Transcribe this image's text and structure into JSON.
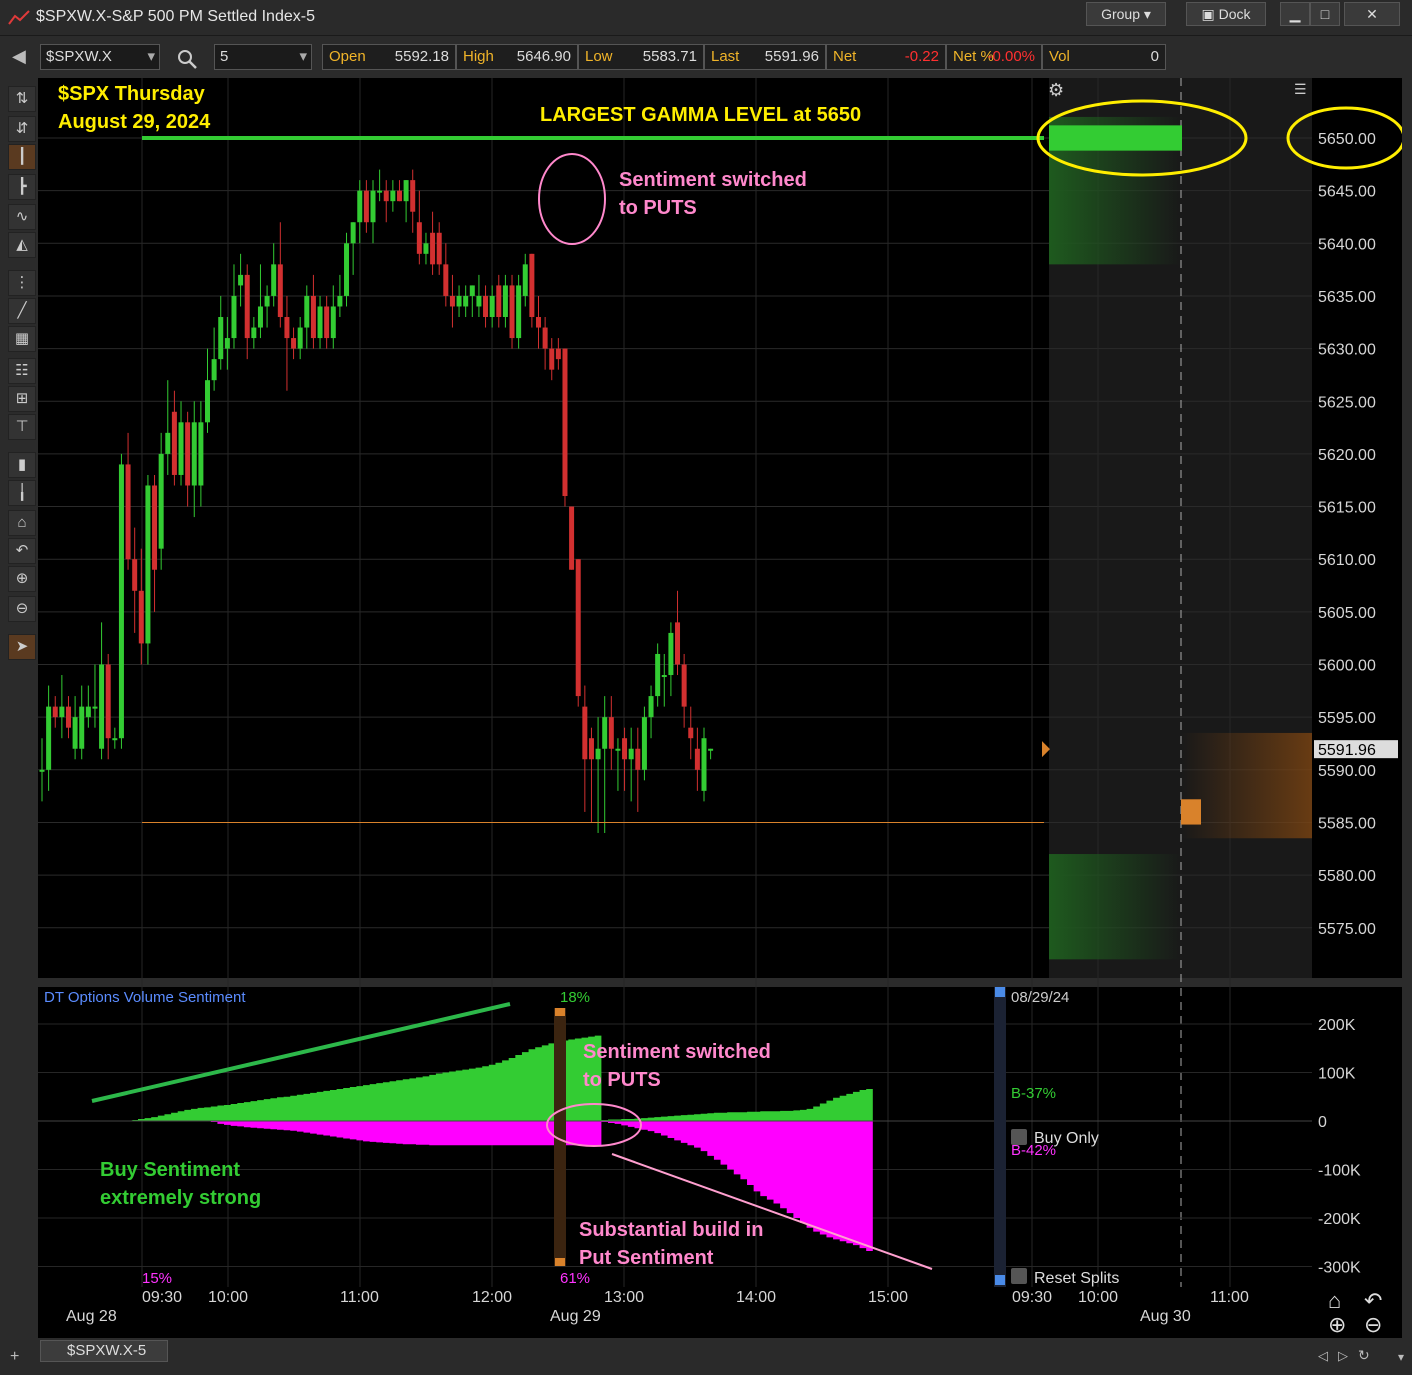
{
  "window": {
    "title": "$SPXW.X-S&P 500 PM Settled Index-5",
    "group_label": "Group",
    "dock_label": "Dock"
  },
  "toolbar": {
    "symbol": "$SPXW.X",
    "interval": "5",
    "quote": [
      {
        "label": "Open",
        "value": "5592.18",
        "neg": false
      },
      {
        "label": "High",
        "value": "5646.90",
        "neg": false
      },
      {
        "label": "Low",
        "value": "5583.71",
        "neg": false
      },
      {
        "label": "Last",
        "value": "5591.96",
        "neg": false
      },
      {
        "label": "Net",
        "value": "-0.22",
        "neg": true
      },
      {
        "label": "Net %",
        "value": "-0.00%",
        "neg": true
      },
      {
        "label": "Vol",
        "value": "0",
        "neg": false
      }
    ]
  },
  "annotations": {
    "title_line1": "$SPX Thursday",
    "title_line2": "August 29, 2024",
    "gamma": "LARGEST GAMMA LEVEL at 5650",
    "sentiment_top_1": "Sentiment switched",
    "sentiment_top_2": "to PUTS",
    "sentiment_bottom_1": "Sentiment switched",
    "sentiment_bottom_2": "to PUTS",
    "buy_1": "Buy Sentiment",
    "buy_2": "extremely strong",
    "put_1": "Substantial build in",
    "put_2": "Put Sentiment"
  },
  "price_axis": {
    "ticks": [
      "5650.00",
      "5645.00",
      "5640.00",
      "5635.00",
      "5630.00",
      "5625.00",
      "5620.00",
      "5615.00",
      "5610.00",
      "5605.00",
      "5600.00",
      "5595.00",
      "5590.00",
      "5585.00",
      "5580.00",
      "5575.00"
    ],
    "last_price_tag": "5591.96"
  },
  "sentiment_panel": {
    "title": "DT Options Volume Sentiment",
    "axis_ticks": [
      "200K",
      "100K",
      "0",
      "-100K",
      "-200K",
      "-300K"
    ],
    "date_label": "08/29/24",
    "split_top_pct": "18%",
    "split_bottom_pct": "61%",
    "left_bottom_pct": "15%",
    "buy_ratio": "B-37%",
    "put_ratio": "B-42%",
    "buy_only_label": "Buy Only",
    "reset_splits_label": "Reset Splits"
  },
  "time_axis": {
    "times": [
      "09:30",
      "10:00",
      "11:00",
      "12:00",
      "13:00",
      "14:00",
      "15:00",
      "09:30",
      "10:00",
      "11:00"
    ],
    "dates": [
      "Aug 28",
      "Aug 29",
      "Aug 30"
    ]
  },
  "status": {
    "tab_label": "$SPXW.X-5"
  },
  "colors": {
    "up": "#33cc33",
    "down": "#d23030",
    "call_area": "#33cc33",
    "put_area": "#ff00ff",
    "annotation_yellow": "#ffee00",
    "annotation_pink": "#ff88cc"
  },
  "chart_data": {
    "type": "candlestick",
    "x_unit": "5-minute bars",
    "ylim": [
      5570,
      5655
    ],
    "gamma_level": 5650,
    "last": 5591.96,
    "candles": [
      {
        "o": 5590,
        "h": 5593,
        "l": 5587,
        "c": 5590
      },
      {
        "o": 5590,
        "h": 5598,
        "l": 5588,
        "c": 5596
      },
      {
        "o": 5596,
        "h": 5597,
        "l": 5594,
        "c": 5595
      },
      {
        "o": 5595,
        "h": 5599,
        "l": 5593,
        "c": 5596
      },
      {
        "o": 5596,
        "h": 5597,
        "l": 5593,
        "c": 5594
      },
      {
        "o": 5592,
        "h": 5597,
        "l": 5591,
        "c": 5595
      },
      {
        "o": 5592,
        "h": 5598,
        "l": 5591,
        "c": 5596
      },
      {
        "o": 5595,
        "h": 5598,
        "l": 5594,
        "c": 5596
      },
      {
        "o": 5596,
        "h": 5600,
        "l": 5594,
        "c": 5596
      },
      {
        "o": 5592,
        "h": 5604,
        "l": 5591,
        "c": 5600
      },
      {
        "o": 5600,
        "h": 5601,
        "l": 5591,
        "c": 5593
      },
      {
        "o": 5593,
        "h": 5594,
        "l": 5592,
        "c": 5593
      },
      {
        "o": 5593,
        "h": 5620,
        "l": 5592,
        "c": 5619
      },
      {
        "o": 5619,
        "h": 5622,
        "l": 5609,
        "c": 5610
      },
      {
        "o": 5610,
        "h": 5613,
        "l": 5603,
        "c": 5607
      },
      {
        "o": 5607,
        "h": 5611,
        "l": 5600,
        "c": 5602
      },
      {
        "o": 5602,
        "h": 5618,
        "l": 5600,
        "c": 5617
      },
      {
        "o": 5617,
        "h": 5618,
        "l": 5605,
        "c": 5609
      },
      {
        "o": 5611,
        "h": 5622,
        "l": 5609,
        "c": 5620
      },
      {
        "o": 5620,
        "h": 5627,
        "l": 5618,
        "c": 5622
      },
      {
        "o": 5624,
        "h": 5626,
        "l": 5617,
        "c": 5618
      },
      {
        "o": 5618,
        "h": 5625,
        "l": 5617,
        "c": 5623
      },
      {
        "o": 5623,
        "h": 5624,
        "l": 5615,
        "c": 5617
      },
      {
        "o": 5617,
        "h": 5625,
        "l": 5614,
        "c": 5623
      },
      {
        "o": 5617,
        "h": 5625,
        "l": 5615,
        "c": 5623
      },
      {
        "o": 5623,
        "h": 5630,
        "l": 5622,
        "c": 5627
      },
      {
        "o": 5627,
        "h": 5632,
        "l": 5626,
        "c": 5629
      },
      {
        "o": 5629,
        "h": 5635,
        "l": 5628,
        "c": 5633
      },
      {
        "o": 5630,
        "h": 5633,
        "l": 5628,
        "c": 5631
      },
      {
        "o": 5631,
        "h": 5638,
        "l": 5630,
        "c": 5635
      },
      {
        "o": 5636,
        "h": 5639,
        "l": 5634,
        "c": 5637
      },
      {
        "o": 5637,
        "h": 5638,
        "l": 5629,
        "c": 5631
      },
      {
        "o": 5631,
        "h": 5633,
        "l": 5630,
        "c": 5632
      },
      {
        "o": 5632,
        "h": 5638,
        "l": 5631,
        "c": 5634
      },
      {
        "o": 5634,
        "h": 5636,
        "l": 5632,
        "c": 5635
      },
      {
        "o": 5635,
        "h": 5640,
        "l": 5634,
        "c": 5638
      },
      {
        "o": 5638,
        "h": 5642,
        "l": 5632,
        "c": 5633
      },
      {
        "o": 5633,
        "h": 5635,
        "l": 5626,
        "c": 5631
      },
      {
        "o": 5631,
        "h": 5632,
        "l": 5629,
        "c": 5630
      },
      {
        "o": 5630,
        "h": 5633,
        "l": 5629,
        "c": 5632
      },
      {
        "o": 5632,
        "h": 5636,
        "l": 5630,
        "c": 5635
      },
      {
        "o": 5635,
        "h": 5637,
        "l": 5630,
        "c": 5631
      },
      {
        "o": 5631,
        "h": 5635,
        "l": 5630,
        "c": 5634
      },
      {
        "o": 5634,
        "h": 5635,
        "l": 5630,
        "c": 5631
      },
      {
        "o": 5631,
        "h": 5636,
        "l": 5630,
        "c": 5634
      },
      {
        "o": 5634,
        "h": 5637,
        "l": 5633,
        "c": 5635
      },
      {
        "o": 5635,
        "h": 5641,
        "l": 5634,
        "c": 5640
      },
      {
        "o": 5640,
        "h": 5642,
        "l": 5637,
        "c": 5642
      },
      {
        "o": 5642,
        "h": 5646,
        "l": 5640,
        "c": 5645
      },
      {
        "o": 5645,
        "h": 5646,
        "l": 5641,
        "c": 5642
      },
      {
        "o": 5642,
        "h": 5646,
        "l": 5640,
        "c": 5645
      },
      {
        "o": 5645,
        "h": 5647,
        "l": 5644,
        "c": 5645
      },
      {
        "o": 5645,
        "h": 5646,
        "l": 5642,
        "c": 5644
      },
      {
        "o": 5644,
        "h": 5646,
        "l": 5643,
        "c": 5645
      },
      {
        "o": 5645,
        "h": 5646,
        "l": 5644,
        "c": 5644
      },
      {
        "o": 5644,
        "h": 5646,
        "l": 5642,
        "c": 5646
      },
      {
        "o": 5646,
        "h": 5647,
        "l": 5641,
        "c": 5643
      },
      {
        "o": 5642,
        "h": 5645,
        "l": 5638,
        "c": 5639
      },
      {
        "o": 5639,
        "h": 5641,
        "l": 5638,
        "c": 5640
      },
      {
        "o": 5641,
        "h": 5643,
        "l": 5637,
        "c": 5638
      },
      {
        "o": 5641,
        "h": 5642,
        "l": 5637,
        "c": 5638
      },
      {
        "o": 5638,
        "h": 5640,
        "l": 5634,
        "c": 5635
      },
      {
        "o": 5635,
        "h": 5637,
        "l": 5632,
        "c": 5634
      },
      {
        "o": 5634,
        "h": 5636,
        "l": 5633,
        "c": 5635
      },
      {
        "o": 5634,
        "h": 5636,
        "l": 5633,
        "c": 5635
      },
      {
        "o": 5635,
        "h": 5636,
        "l": 5633,
        "c": 5636
      },
      {
        "o": 5634,
        "h": 5637,
        "l": 5633,
        "c": 5635
      },
      {
        "o": 5635,
        "h": 5636,
        "l": 5632,
        "c": 5633
      },
      {
        "o": 5633,
        "h": 5636,
        "l": 5632,
        "c": 5635
      },
      {
        "o": 5636,
        "h": 5637,
        "l": 5632,
        "c": 5633
      },
      {
        "o": 5633,
        "h": 5637,
        "l": 5632,
        "c": 5636
      },
      {
        "o": 5636,
        "h": 5637,
        "l": 5630,
        "c": 5631
      },
      {
        "o": 5631,
        "h": 5637,
        "l": 5630,
        "c": 5636
      },
      {
        "o": 5635,
        "h": 5639,
        "l": 5634,
        "c": 5638
      },
      {
        "o": 5639,
        "h": 5639,
        "l": 5632,
        "c": 5633
      },
      {
        "o": 5633,
        "h": 5635,
        "l": 5630,
        "c": 5632
      },
      {
        "o": 5632,
        "h": 5633,
        "l": 5628,
        "c": 5630
      },
      {
        "o": 5630,
        "h": 5631,
        "l": 5627,
        "c": 5628
      },
      {
        "o": 5630,
        "h": 5631,
        "l": 5628,
        "c": 5629
      },
      {
        "o": 5630,
        "h": 5630,
        "l": 5615,
        "c": 5616
      },
      {
        "o": 5615,
        "h": 5615,
        "l": 5609,
        "c": 5609
      },
      {
        "o": 5610,
        "h": 5610,
        "l": 5596,
        "c": 5597
      },
      {
        "o": 5596,
        "h": 5598,
        "l": 5586,
        "c": 5591
      },
      {
        "o": 5593,
        "h": 5594,
        "l": 5585,
        "c": 5591
      },
      {
        "o": 5591,
        "h": 5595,
        "l": 5584,
        "c": 5592
      },
      {
        "o": 5592,
        "h": 5597,
        "l": 5584,
        "c": 5595
      },
      {
        "o": 5595,
        "h": 5597,
        "l": 5590,
        "c": 5592
      },
      {
        "o": 5592,
        "h": 5593,
        "l": 5588,
        "c": 5592
      },
      {
        "o": 5593,
        "h": 5594,
        "l": 5588,
        "c": 5591
      },
      {
        "o": 5591,
        "h": 5594,
        "l": 5587,
        "c": 5592
      },
      {
        "o": 5592,
        "h": 5594,
        "l": 5586,
        "c": 5590
      },
      {
        "o": 5590,
        "h": 5596,
        "l": 5589,
        "c": 5595
      },
      {
        "o": 5595,
        "h": 5598,
        "l": 5593,
        "c": 5597
      },
      {
        "o": 5597,
        "h": 5602,
        "l": 5596,
        "c": 5601
      },
      {
        "o": 5599,
        "h": 5601,
        "l": 5596,
        "c": 5599
      },
      {
        "o": 5599,
        "h": 5604,
        "l": 5597,
        "c": 5603
      },
      {
        "o": 5604,
        "h": 5607,
        "l": 5599,
        "c": 5600
      },
      {
        "o": 5600,
        "h": 5601,
        "l": 5594,
        "c": 5596
      },
      {
        "o": 5594,
        "h": 5596,
        "l": 5591,
        "c": 5593
      },
      {
        "o": 5592,
        "h": 5594,
        "l": 5588,
        "c": 5590
      },
      {
        "o": 5588,
        "h": 5594,
        "l": 5587,
        "c": 5593
      },
      {
        "o": 5592,
        "h": 5592,
        "l": 5591,
        "c": 5592
      }
    ],
    "sentiment": {
      "calls": [
        0.02,
        0.04,
        0.06,
        0.08,
        0.11,
        0.14,
        0.17,
        0.2,
        0.23,
        0.25,
        0.27,
        0.28,
        0.3,
        0.32,
        0.33,
        0.35,
        0.37,
        0.39,
        0.41,
        0.43,
        0.45,
        0.47,
        0.49,
        0.5,
        0.52,
        0.54,
        0.56,
        0.58,
        0.6,
        0.62,
        0.64,
        0.66,
        0.68,
        0.7,
        0.72,
        0.74,
        0.76,
        0.78,
        0.8,
        0.82,
        0.84,
        0.86,
        0.88,
        0.9,
        0.92,
        0.95,
        0.98,
        1.0,
        1.02,
        1.04,
        1.06,
        1.08,
        1.1,
        1.13,
        1.16,
        1.2,
        1.25,
        1.3,
        1.36,
        1.42,
        1.48,
        1.52,
        1.56,
        1.6,
        1.63,
        1.66,
        1.68,
        1.7,
        1.72,
        1.74,
        1.76,
        0.02,
        0.03,
        0.03,
        0.04,
        0.04,
        0.05,
        0.06,
        0.07,
        0.08,
        0.09,
        0.1,
        0.11,
        0.12,
        0.13,
        0.14,
        0.15,
        0.16,
        0.17,
        0.17,
        0.18,
        0.18,
        0.18,
        0.19,
        0.19,
        0.2,
        0.2,
        0.2,
        0.21,
        0.21,
        0.22,
        0.23,
        0.25,
        0.3,
        0.36,
        0.42,
        0.48,
        0.52,
        0.56,
        0.6,
        0.64,
        0.66
      ],
      "puts": [
        0,
        0,
        0,
        0,
        0,
        0,
        0,
        0,
        0,
        0,
        0,
        0,
        -0.02,
        -0.06,
        -0.08,
        -0.1,
        -0.11,
        -0.13,
        -0.14,
        -0.15,
        -0.16,
        -0.17,
        -0.18,
        -0.19,
        -0.2,
        -0.22,
        -0.24,
        -0.26,
        -0.28,
        -0.3,
        -0.32,
        -0.34,
        -0.36,
        -0.38,
        -0.4,
        -0.42,
        -0.43,
        -0.44,
        -0.45,
        -0.46,
        -0.47,
        -0.48,
        -0.48,
        -0.49,
        -0.49,
        -0.5,
        -0.5,
        -0.5,
        -0.5,
        -0.5,
        -0.5,
        -0.5,
        -0.5,
        -0.5,
        -0.5,
        -0.5,
        -0.5,
        -0.5,
        -0.5,
        -0.5,
        -0.5,
        -0.5,
        -0.5,
        -0.5,
        -0.5,
        -0.5,
        -0.5,
        -0.5,
        -0.5,
        -0.5,
        -0.5,
        -0.02,
        -0.04,
        -0.06,
        -0.09,
        -0.12,
        -0.15,
        -0.18,
        -0.21,
        -0.25,
        -0.3,
        -0.35,
        -0.4,
        -0.45,
        -0.5,
        -0.55,
        -0.62,
        -0.72,
        -0.8,
        -0.9,
        -1.0,
        -1.1,
        -1.2,
        -1.32,
        -1.45,
        -1.55,
        -1.62,
        -1.7,
        -1.8,
        -1.9,
        -2.0,
        -2.1,
        -2.2,
        -2.28,
        -2.34,
        -2.4,
        -2.44,
        -2.48,
        -2.52,
        -2.56,
        -2.62,
        -2.68
      ],
      "unit": "x100K"
    }
  }
}
